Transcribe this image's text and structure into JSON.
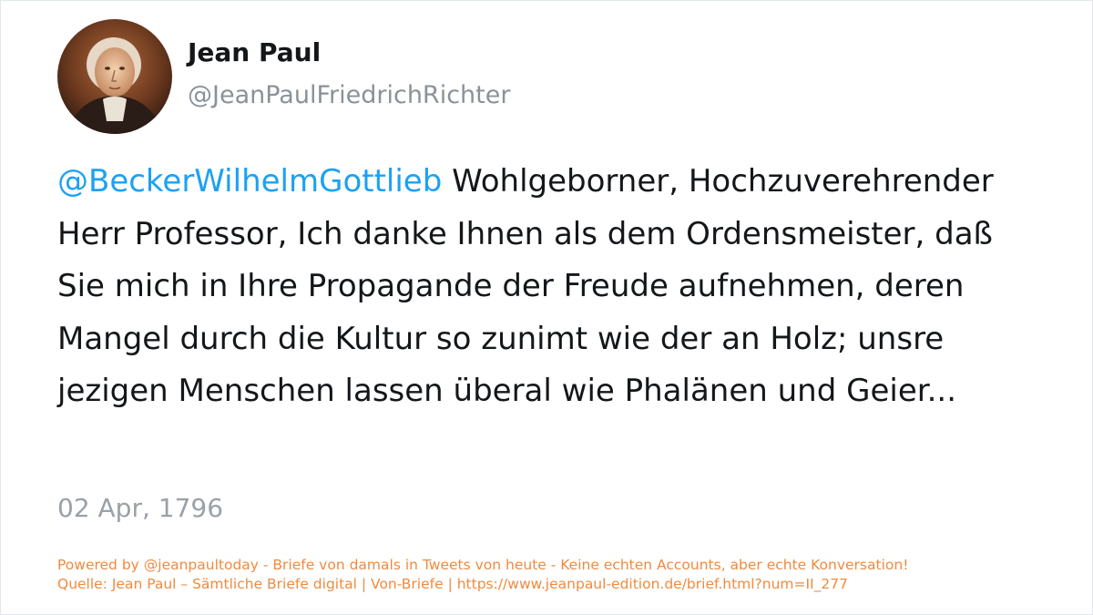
{
  "author": {
    "display_name": "Jean Paul",
    "handle": "@JeanPaulFriedrichRichter",
    "avatar_icon": "portrait-avatar"
  },
  "tweet": {
    "mention": "@BeckerWilhelmGottlieb",
    "body": " Wohlgeborner, Hochzuverehrender Herr Professor, Ich danke Ihnen als dem Ordensmeister, daß Sie mich in Ihre Propagande der Freude aufnehmen, deren Mangel durch die Kultur so zunimt wie der an Holz; unsre jezigen Menschen lassen überal wie Phalänen und Geier...",
    "date": "02 Apr, 1796"
  },
  "footer": {
    "powered_by": "Powered by @jeanpaultoday - Briefe von damals in Tweets von heute - Keine echten Accounts, aber echte Konversation!",
    "source": "Quelle: Jean Paul – Sämtliche Briefe digital | Von-Briefe | https://www.jeanpaul-edition.de/brief.html?num=II_277"
  },
  "colors": {
    "mention": "#1da1f2",
    "text": "#14171a",
    "muted": "#8a9299",
    "footer": "#f08a3e"
  }
}
